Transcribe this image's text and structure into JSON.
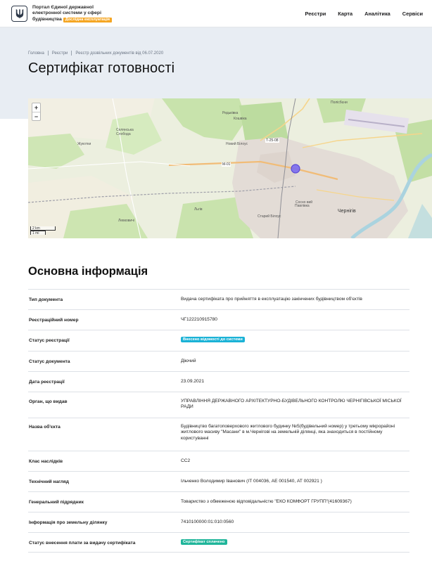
{
  "header": {
    "brand_line1": "Портал Єдиної державної",
    "brand_line2": "електронної системи у сфері",
    "brand_line3": "будівництва",
    "beta_badge": "Дослідна експлуатація",
    "logo_icon": "trident-icon",
    "nav": [
      {
        "label": "Реєстри"
      },
      {
        "label": "Карта"
      },
      {
        "label": "Аналітика"
      },
      {
        "label": "Сервіси"
      }
    ]
  },
  "breadcrumb": [
    {
      "label": "Головна"
    },
    {
      "label": "Реєстри"
    },
    {
      "label": "Реєстр дозвільних документів від 06.07.2020"
    }
  ],
  "page_title": "Сертифікат готовності",
  "map": {
    "zoom_in": "+",
    "zoom_out": "−",
    "scale_km": "2 km",
    "scale_mi": "1 mi",
    "labels": {
      "poliskyi": "Полісбєни",
      "redkivka": "Редьківка",
      "koshelevka": "Кошвіка",
      "seliansk": "Селянська Слобода",
      "zhukotky": "Жукотки",
      "novyi_bilous": "Новий Білоус",
      "road_t2508": "Т-25-08",
      "road_m01": "М-01",
      "liubech": "Льгів",
      "levkovychi": "Левковичі",
      "staryi_bilous": "Старий Білоус",
      "podusivka": "Павлівка",
      "chernihiv": "Чернігів",
      "sosnovyi": "Сосно вий"
    },
    "marker_icon": "location-marker-icon"
  },
  "main": {
    "section_title": "Основна інформація",
    "rows": [
      {
        "label": "Тип документа",
        "value": "Видача сертифіката про прийняття в експлуатацію закінчених будівництвом об'єктів"
      },
      {
        "label": "Реєстраційний номер",
        "value": "ЧГ122210915780"
      },
      {
        "label": "Статус реєстрації",
        "tag": "Внесено відомості до системи",
        "tag_color": "#1ab2d6"
      },
      {
        "label": "Статус документа",
        "value": "Діючий"
      },
      {
        "label": "Дата реєстрації",
        "value": "23.09.2021"
      },
      {
        "label": "Орган, що видав",
        "value": "УПРАВЛІННЯ ДЕРЖАВНОГО АРХІТЕКТУРНО-БУДІВЕЛЬНОГО КОНТРОЛЮ ЧЕРНІГІВСЬКОЇ МІСЬКОЇ РАДИ"
      },
      {
        "label": "Назва об'єкта",
        "value": "Будівництво багатоповерхового житлового будинку №5(будівельний номер) у третьому мікрорайоні житлового масиву \"Масани\" в м.Чернігові на земельній ділянці, яка знаходиться в постійному користуванні"
      },
      {
        "label": "Клас наслідків",
        "value": "СС2"
      },
      {
        "label": "Технічний нагляд",
        "value": "Ільченко Володимир Іванович (ІТ 004036, АЕ 001540, АТ 002921 )"
      },
      {
        "label": "Генеральний підрядник",
        "value": "Товариство з обмеженою відповідальністю \"ЕКО КОМФОРТ ГРУПП\"(41609367)"
      },
      {
        "label": "Інформація про земельну ділянку",
        "value": "7410100000:01:010:0560"
      },
      {
        "label": "Статус внесення плати за видачу сертифіката",
        "tag": "Сертифікат сплачено",
        "tag_color": "#1fb59a"
      }
    ]
  }
}
